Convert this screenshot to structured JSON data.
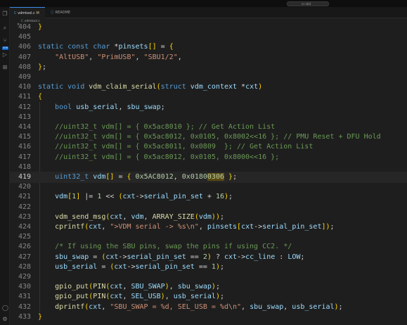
{
  "titlebar": {
    "search_label": "cc-sbd"
  },
  "activity": {
    "badge": "406"
  },
  "tabs": [
    {
      "label": "vdmtool.c",
      "modified": "M"
    },
    {
      "label": "README"
    }
  ],
  "breadcrumb": "vdmtool.c",
  "current_line": 419,
  "lines": [
    {
      "n": 404,
      "code": "}"
    },
    {
      "n": 405,
      "code": ""
    },
    {
      "n": 406,
      "code": "static const char *pinsets[] = {"
    },
    {
      "n": 407,
      "code": "    \"AltUSB\", \"PrimUSB\", \"SBU1/2\","
    },
    {
      "n": 408,
      "code": "};"
    },
    {
      "n": 409,
      "code": ""
    },
    {
      "n": 410,
      "code": "static void vdm_claim_serial(struct vdm_context *cxt)"
    },
    {
      "n": 411,
      "code": "{"
    },
    {
      "n": 412,
      "code": "    bool usb_serial, sbu_swap;"
    },
    {
      "n": 413,
      "code": ""
    },
    {
      "n": 414,
      "code": "    //uint32_t vdm[] = { 0x5ac8010 }; // Get Action List"
    },
    {
      "n": 415,
      "code": "    //uint32_t vdm[] = { 0x5ac8012, 0x0105, 0x8002<<16 }; // PMU Reset + DFU Hold"
    },
    {
      "n": 416,
      "code": "    //uint32_t vdm[] = { 0x5ac8011, 0x0809  }; // Get Action List"
    },
    {
      "n": 417,
      "code": "    //uint32_t vdm[] = { 0x5ac8012, 0x0105, 0x8000<<16 };"
    },
    {
      "n": 418,
      "code": ""
    },
    {
      "n": 419,
      "code": "    uint32_t vdm[] = { 0x5AC8012, 0x01800306 };"
    },
    {
      "n": 420,
      "code": ""
    },
    {
      "n": 421,
      "code": "    vdm[1] |= 1 << (cxt->serial_pin_set + 16);"
    },
    {
      "n": 422,
      "code": ""
    },
    {
      "n": 423,
      "code": "    vdm_send_msg(cxt, vdm, ARRAY_SIZE(vdm));"
    },
    {
      "n": 424,
      "code": "    cprintf(cxt, \">VDM serial -> %s\\n\", pinsets[cxt->serial_pin_set]);"
    },
    {
      "n": 425,
      "code": ""
    },
    {
      "n": 426,
      "code": "    /* If using the SBU pins, swap the pins if using CC2. */"
    },
    {
      "n": 427,
      "code": "    sbu_swap = (cxt->serial_pin_set == 2) ? cxt->cc_line : LOW;"
    },
    {
      "n": 428,
      "code": "    usb_serial = (cxt->serial_pin_set == 1);"
    },
    {
      "n": 429,
      "code": ""
    },
    {
      "n": 430,
      "code": "    gpio_put(PIN(cxt, SBU_SWAP), sbu_swap);"
    },
    {
      "n": 431,
      "code": "    gpio_put(PIN(cxt, SEL_USB), usb_serial);"
    },
    {
      "n": 432,
      "code": "    dprintf(cxt, \"SBU_SWAP = %d, SEL_USB = %d\\n\", sbu_swap, usb_serial);"
    },
    {
      "n": 433,
      "code": "}"
    }
  ]
}
